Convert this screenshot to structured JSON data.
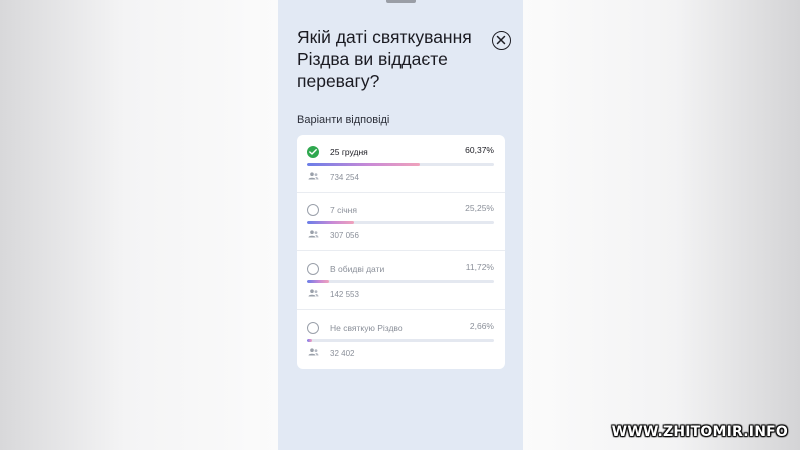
{
  "poll": {
    "question": "Якій даті святкування Різдва ви віддаєте перевагу?",
    "answers_label": "Варіанти відповіді",
    "options": [
      {
        "label": "25 грудня",
        "percent_text": "60,37%",
        "percent": 60.37,
        "votes": "734 254",
        "selected": true
      },
      {
        "label": "7 січня",
        "percent_text": "25,25%",
        "percent": 25.25,
        "votes": "307 056",
        "selected": false
      },
      {
        "label": "В обидві дати",
        "percent_text": "11,72%",
        "percent": 11.72,
        "votes": "142 553",
        "selected": false
      },
      {
        "label": "Не святкую Різдво",
        "percent_text": "2,66%",
        "percent": 2.66,
        "votes": "32 402",
        "selected": false
      }
    ]
  },
  "icons": {
    "close": "close-icon",
    "check": "check-icon",
    "users": "users-icon"
  },
  "colors": {
    "selected_check": "#2fa84f",
    "bar_gradient_start": "#6a7de8",
    "bar_gradient_end": "#f0a2bb",
    "panel_background": "#e2e9f4"
  },
  "watermark": "WWW.ZHITOMIR.INFO"
}
